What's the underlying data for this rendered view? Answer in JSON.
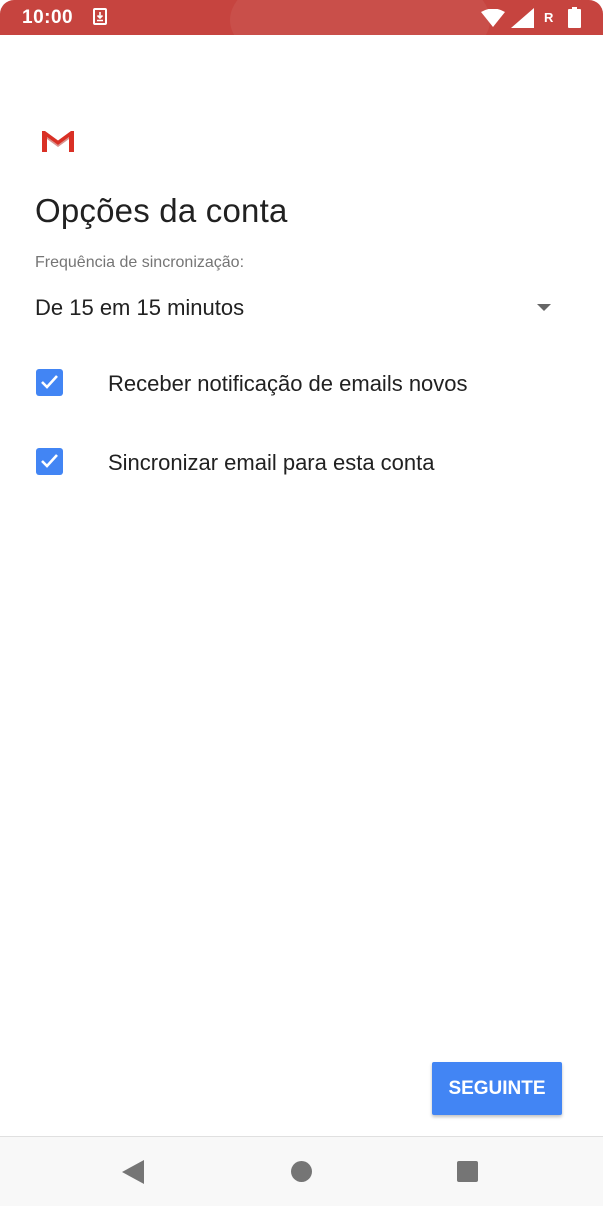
{
  "status_bar": {
    "time": "10:00",
    "roaming_indicator": "R",
    "icons": [
      "download-icon",
      "wifi-icon",
      "cell-signal-icon",
      "battery-icon"
    ],
    "color": "#c6443f"
  },
  "app": {
    "logo": "gmail-logo"
  },
  "page": {
    "title": "Opções da conta",
    "sync_label": "Frequência de sincronização:",
    "sync_value": "De 15 em 15 minutos"
  },
  "options": [
    {
      "label": "Receber notificação de emails novos",
      "checked": true
    },
    {
      "label": "Sincronizar email para esta conta",
      "checked": true
    }
  ],
  "actions": {
    "next_label": "SEGUINTE"
  },
  "colors": {
    "accent": "#4285f4",
    "status_bar": "#c6443f",
    "gmail_red": "#d93025"
  },
  "nav_bar": {
    "icons": [
      "back-icon",
      "home-icon",
      "recents-icon"
    ]
  }
}
